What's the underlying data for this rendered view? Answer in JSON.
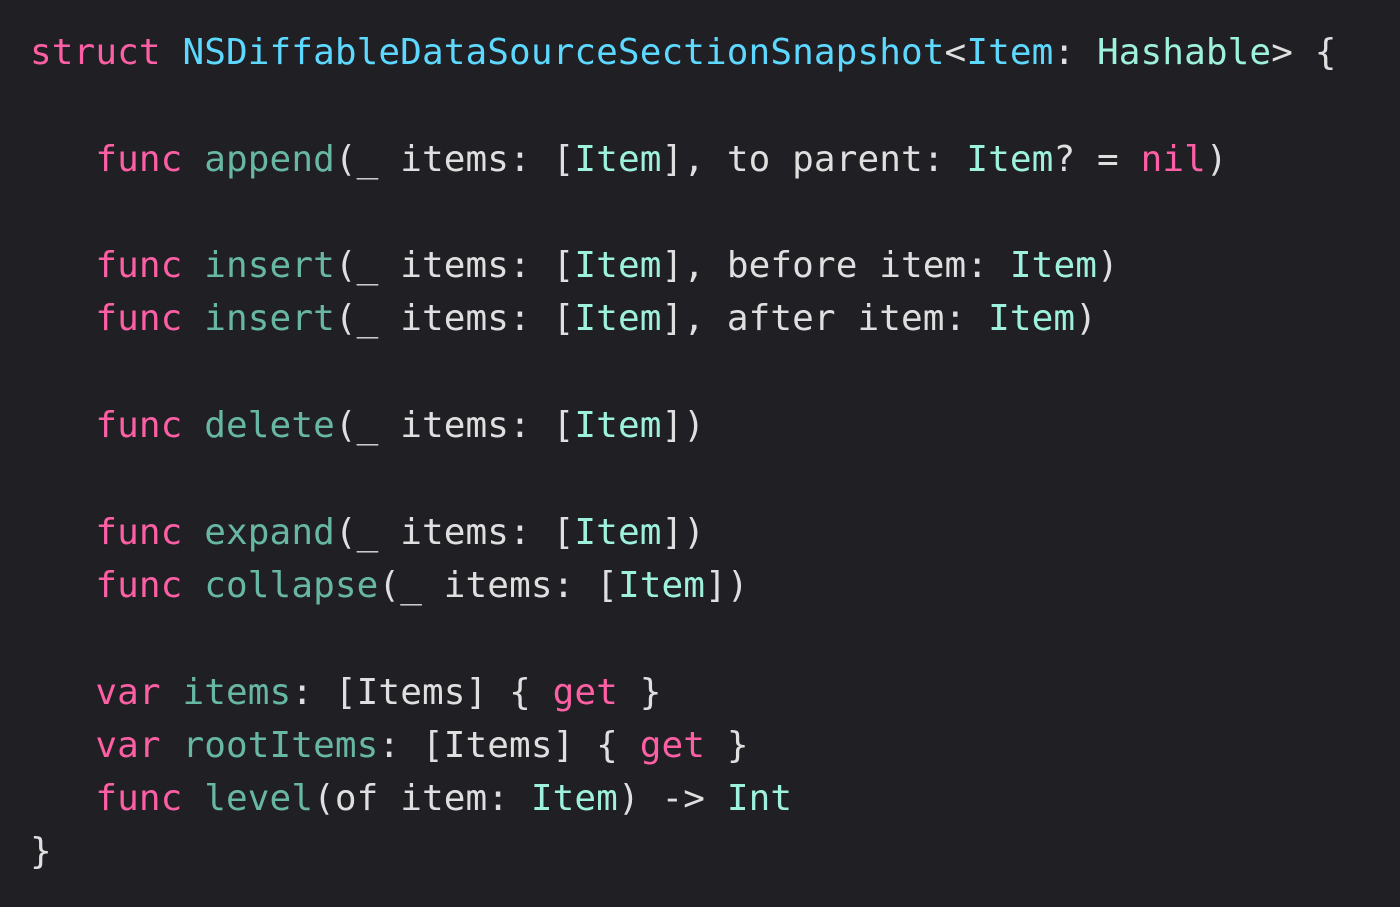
{
  "colors": {
    "background": "#1f1f24",
    "plain": "#dfdfe0",
    "keyword": "#fc5fa3",
    "type_declaration": "#5dd8ff",
    "function_declaration": "#67b7a4",
    "type": "#d0bf69",
    "param_type": "#9ef1dd",
    "property": "#a167e6"
  },
  "code_lines": [
    {
      "indent": "",
      "tokens": [
        {
          "text": "struct",
          "color": "#fc5fa3"
        },
        {
          "text": " ",
          "color": "#dfdfe0"
        },
        {
          "text": "NSDiffableDataSourceSectionSnapshot",
          "color": "#5dd8ff"
        },
        {
          "text": "<",
          "color": "#dfdfe0"
        },
        {
          "text": "Item",
          "color": "#5dd8ff"
        },
        {
          "text": ": ",
          "color": "#dfdfe0"
        },
        {
          "text": "Hashable",
          "color": "#9ef1dd"
        },
        {
          "text": "> {",
          "color": "#dfdfe0"
        }
      ]
    },
    {
      "indent": "",
      "tokens": []
    },
    {
      "indent": "   ",
      "tokens": [
        {
          "text": "func",
          "color": "#fc5fa3"
        },
        {
          "text": " ",
          "color": "#dfdfe0"
        },
        {
          "text": "append",
          "color": "#67b7a4"
        },
        {
          "text": "(_ items: [",
          "color": "#dfdfe0"
        },
        {
          "text": "Item",
          "color": "#9ef1dd"
        },
        {
          "text": "], to parent: ",
          "color": "#dfdfe0"
        },
        {
          "text": "Item",
          "color": "#9ef1dd"
        },
        {
          "text": "? = ",
          "color": "#dfdfe0"
        },
        {
          "text": "nil",
          "color": "#fc5fa3"
        },
        {
          "text": ")",
          "color": "#dfdfe0"
        }
      ]
    },
    {
      "indent": "",
      "tokens": []
    },
    {
      "indent": "   ",
      "tokens": [
        {
          "text": "func",
          "color": "#fc5fa3"
        },
        {
          "text": " ",
          "color": "#dfdfe0"
        },
        {
          "text": "insert",
          "color": "#67b7a4"
        },
        {
          "text": "(_ items: [",
          "color": "#dfdfe0"
        },
        {
          "text": "Item",
          "color": "#9ef1dd"
        },
        {
          "text": "], before item: ",
          "color": "#dfdfe0"
        },
        {
          "text": "Item",
          "color": "#9ef1dd"
        },
        {
          "text": ")",
          "color": "#dfdfe0"
        }
      ]
    },
    {
      "indent": "   ",
      "tokens": [
        {
          "text": "func",
          "color": "#fc5fa3"
        },
        {
          "text": " ",
          "color": "#dfdfe0"
        },
        {
          "text": "insert",
          "color": "#67b7a4"
        },
        {
          "text": "(_ items: [",
          "color": "#dfdfe0"
        },
        {
          "text": "Item",
          "color": "#9ef1dd"
        },
        {
          "text": "], after item: ",
          "color": "#dfdfe0"
        },
        {
          "text": "Item",
          "color": "#9ef1dd"
        },
        {
          "text": ")",
          "color": "#dfdfe0"
        }
      ]
    },
    {
      "indent": "",
      "tokens": []
    },
    {
      "indent": "   ",
      "tokens": [
        {
          "text": "func",
          "color": "#fc5fa3"
        },
        {
          "text": " ",
          "color": "#dfdfe0"
        },
        {
          "text": "delete",
          "color": "#67b7a4"
        },
        {
          "text": "(_ items: [",
          "color": "#dfdfe0"
        },
        {
          "text": "Item",
          "color": "#9ef1dd"
        },
        {
          "text": "])",
          "color": "#dfdfe0"
        }
      ]
    },
    {
      "indent": "",
      "tokens": []
    },
    {
      "indent": "   ",
      "tokens": [
        {
          "text": "func",
          "color": "#fc5fa3"
        },
        {
          "text": " ",
          "color": "#dfdfe0"
        },
        {
          "text": "expand",
          "color": "#67b7a4"
        },
        {
          "text": "(_ items: [",
          "color": "#dfdfe0"
        },
        {
          "text": "Item",
          "color": "#9ef1dd"
        },
        {
          "text": "])",
          "color": "#dfdfe0"
        }
      ]
    },
    {
      "indent": "   ",
      "tokens": [
        {
          "text": "func",
          "color": "#fc5fa3"
        },
        {
          "text": " ",
          "color": "#dfdfe0"
        },
        {
          "text": "collapse",
          "color": "#67b7a4"
        },
        {
          "text": "(_ items: [",
          "color": "#dfdfe0"
        },
        {
          "text": "Item",
          "color": "#9ef1dd"
        },
        {
          "text": "])",
          "color": "#dfdfe0"
        }
      ]
    },
    {
      "indent": "",
      "tokens": []
    },
    {
      "indent": "   ",
      "tokens": [
        {
          "text": "var",
          "color": "#fc5fa3"
        },
        {
          "text": " ",
          "color": "#dfdfe0"
        },
        {
          "text": "items",
          "color": "#67b7a4"
        },
        {
          "text": ": [",
          "color": "#dfdfe0"
        },
        {
          "text": "Items",
          "color": "#dfdfe0"
        },
        {
          "text": "] { ",
          "color": "#dfdfe0"
        },
        {
          "text": "get",
          "color": "#fc5fa3"
        },
        {
          "text": " }",
          "color": "#dfdfe0"
        }
      ]
    },
    {
      "indent": "   ",
      "tokens": [
        {
          "text": "var",
          "color": "#fc5fa3"
        },
        {
          "text": " ",
          "color": "#dfdfe0"
        },
        {
          "text": "rootItems",
          "color": "#67b7a4"
        },
        {
          "text": ": [",
          "color": "#dfdfe0"
        },
        {
          "text": "Items",
          "color": "#dfdfe0"
        },
        {
          "text": "] { ",
          "color": "#dfdfe0"
        },
        {
          "text": "get",
          "color": "#fc5fa3"
        },
        {
          "text": " }",
          "color": "#dfdfe0"
        }
      ]
    },
    {
      "indent": "   ",
      "tokens": [
        {
          "text": "func",
          "color": "#fc5fa3"
        },
        {
          "text": " ",
          "color": "#dfdfe0"
        },
        {
          "text": "level",
          "color": "#67b7a4"
        },
        {
          "text": "(of item: ",
          "color": "#dfdfe0"
        },
        {
          "text": "Item",
          "color": "#9ef1dd"
        },
        {
          "text": ") -> ",
          "color": "#dfdfe0"
        },
        {
          "text": "Int",
          "color": "#9ef1dd"
        }
      ]
    },
    {
      "indent": "",
      "tokens": [
        {
          "text": "}",
          "color": "#dfdfe0"
        }
      ]
    }
  ]
}
